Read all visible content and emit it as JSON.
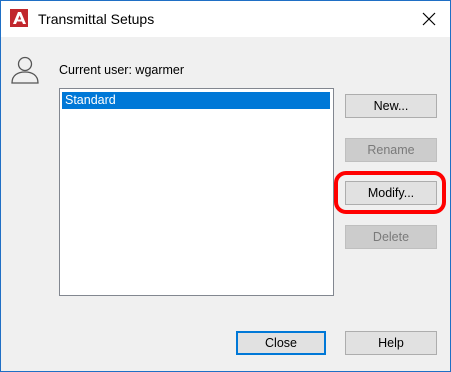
{
  "window": {
    "title": "Transmittal Setups",
    "app_icon": "autocad-logo-icon",
    "close_icon": "close-icon"
  },
  "user": {
    "icon": "user-icon",
    "label": "Current user: wgarmer"
  },
  "setups": {
    "items": [
      {
        "label": "Standard",
        "selected": true
      }
    ]
  },
  "buttons": {
    "new": {
      "label": "New...",
      "enabled": true
    },
    "rename": {
      "label": "Rename",
      "enabled": false
    },
    "modify": {
      "label": "Modify...",
      "enabled": true,
      "highlighted": true
    },
    "delete": {
      "label": "Delete",
      "enabled": false
    },
    "close": {
      "label": "Close",
      "enabled": true,
      "default": true
    },
    "help": {
      "label": "Help",
      "enabled": true
    }
  },
  "colors": {
    "selection": "#0078d7",
    "highlight_ring": "#ff0000",
    "brand_red": "#c1272d"
  }
}
